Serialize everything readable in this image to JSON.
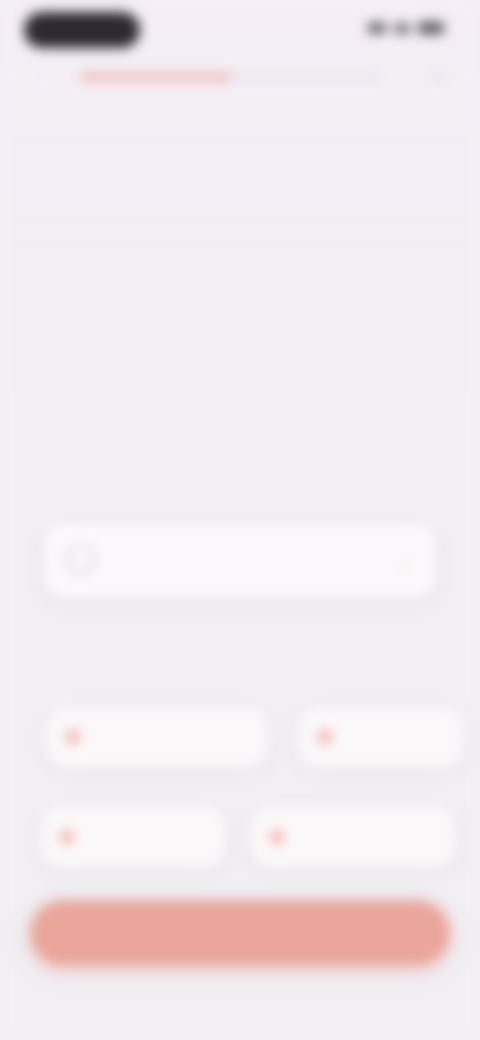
{
  "status_bar": {
    "time": "",
    "icons": [
      "signal-icon",
      "wifi-icon",
      "battery-icon"
    ]
  },
  "nav": {
    "back_icon": "chevron-left-icon",
    "close_icon": "close-icon",
    "progress_fraction": 0.5
  },
  "header": {
    "title": "",
    "title_accent": "",
    "subtitle": ""
  },
  "search": {
    "value": "",
    "placeholder": "",
    "icon": "search-icon",
    "submit_icon": "arrow-right-icon"
  },
  "suggestions": {
    "label": "",
    "chips": [
      {
        "label": ""
      },
      {
        "label": ""
      },
      {
        "label": ""
      },
      {
        "label": ""
      }
    ]
  },
  "primary_action": {
    "label": ""
  },
  "colors": {
    "accent": "#eaa69b",
    "accent_light": "#f0b1a7",
    "background": "#f2eff4",
    "text_dark": "#3a3640"
  }
}
